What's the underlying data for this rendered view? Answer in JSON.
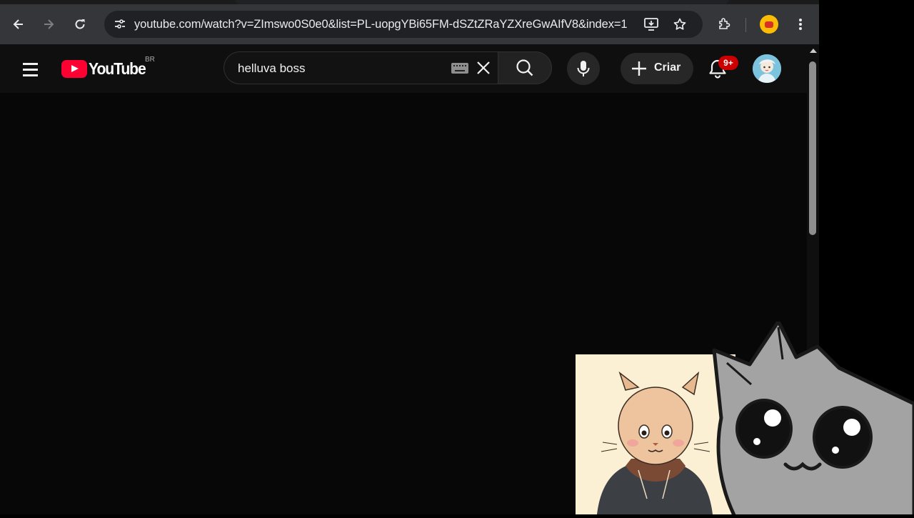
{
  "browser": {
    "url_domain": "youtube.com",
    "url_path": "/watch?v=ZImswo0S0e0&list=PL-uopgYBi65FM-dSZtZRaYZXreGwAIfV8&index=1",
    "nav_icons": [
      "back-arrow-icon",
      "forward-arrow-icon",
      "reload-icon"
    ],
    "omnibox_icons": [
      "site-info-icon",
      "install-app-icon",
      "bookmark-star-icon"
    ],
    "toolbar_icons": [
      "extensions-icon",
      "profile-icon",
      "menu-kebab-icon"
    ]
  },
  "youtube": {
    "logo_text": "YouTube",
    "country_code": "BR",
    "search": {
      "query": "helluva boss",
      "icons": [
        "keyboard-icon",
        "clear-icon",
        "search-icon"
      ]
    },
    "mic_icon": "microphone-icon",
    "create_label": "Criar",
    "notifications_badge": "9+",
    "accent_color": "#ff0033"
  },
  "overlay": {
    "left_image": "illustrated-cat-character-in-hoodie",
    "right_image": "gray-cartoon-cat-mascot"
  }
}
